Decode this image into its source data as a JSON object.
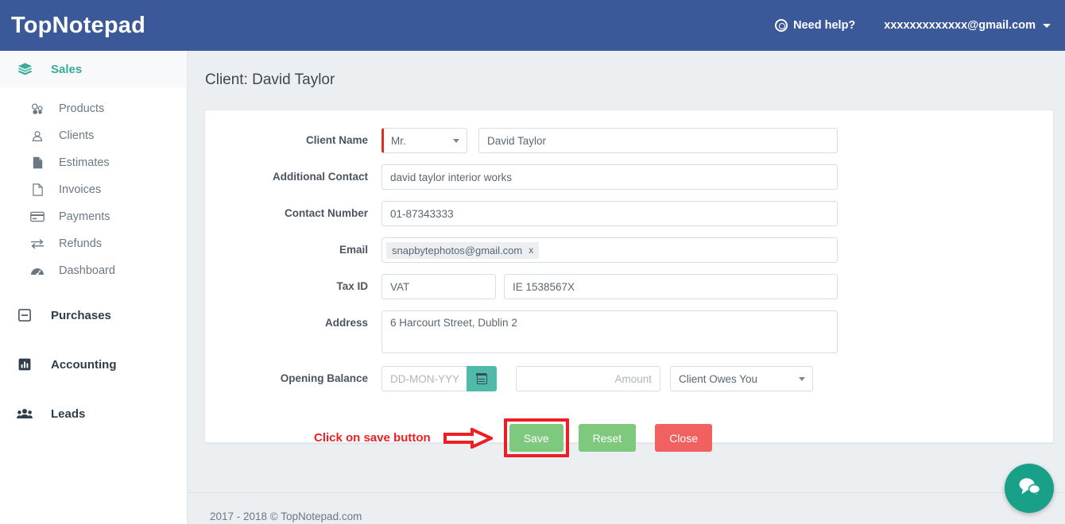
{
  "header": {
    "logo_top": "Top",
    "logo_note": "Notepad",
    "help_label": "Need help?",
    "help_icon": "life-ring-icon",
    "user_email": "xxxxxxxxxxxxx@gmail.com",
    "caret_icon": "caret-down-icon",
    "bg_color": "#3b5998"
  },
  "sidebar": {
    "groups": [
      {
        "label": "Sales",
        "icon": "layers-icon",
        "active": true,
        "color": "#3aab9b"
      },
      {
        "label": "Purchases",
        "icon": "minus-square-icon",
        "active": false,
        "color": "#2f3d4a"
      },
      {
        "label": "Accounting",
        "icon": "bar-chart-icon",
        "active": false,
        "color": "#2f3d4a"
      },
      {
        "label": "Leads",
        "icon": "users-icon",
        "active": false,
        "color": "#2f3d4a"
      }
    ],
    "sales_items": [
      {
        "label": "Products",
        "icon": "cubes-icon"
      },
      {
        "label": "Clients",
        "icon": "user-circle-icon"
      },
      {
        "label": "Estimates",
        "icon": "file-filled-icon"
      },
      {
        "label": "Invoices",
        "icon": "file-outline-icon"
      },
      {
        "label": "Payments",
        "icon": "credit-card-icon"
      },
      {
        "label": "Refunds",
        "icon": "exchange-icon"
      },
      {
        "label": "Dashboard",
        "icon": "dashboard-gauge-icon"
      }
    ]
  },
  "page": {
    "title": "Client: David Taylor"
  },
  "form": {
    "client_name": {
      "label": "Client Name",
      "salutation_value": "Mr.",
      "name_value": "David Taylor",
      "name_placeholder": "",
      "required": true
    },
    "additional_contact": {
      "label": "Additional Contact",
      "value": "david taylor interior works"
    },
    "contact_number": {
      "label": "Contact Number",
      "value": "01-87343333"
    },
    "email": {
      "label": "Email",
      "tag": "snapbytephotos@gmail.com",
      "tag_remove": "x"
    },
    "tax_id": {
      "label": "Tax ID",
      "type_value": "VAT",
      "number_value": "IE 1538567X"
    },
    "address": {
      "label": "Address",
      "value": "6 Harcourt Street, Dublin 2"
    },
    "opening_balance": {
      "label": "Opening Balance",
      "date_placeholder": "DD-MON-YYYY",
      "date_value": "",
      "calendar_icon": "calendar-icon",
      "amount_placeholder": "Amount",
      "amount_value": "",
      "direction_value": "Client Owes You"
    }
  },
  "actions": {
    "annotation_text": "Click on save button",
    "annotation_arrow": "right-arrow-icon",
    "save_label": "Save",
    "reset_label": "Reset",
    "close_label": "Close",
    "highlight_color": "#ee1f24",
    "save_color": "#7ec97e",
    "close_color": "#f0615f"
  },
  "footer": {
    "copyright": "2017 - 2018 © TopNotepad.com"
  },
  "chat": {
    "icon": "chat-bubbles-icon",
    "color": "#18a188"
  }
}
